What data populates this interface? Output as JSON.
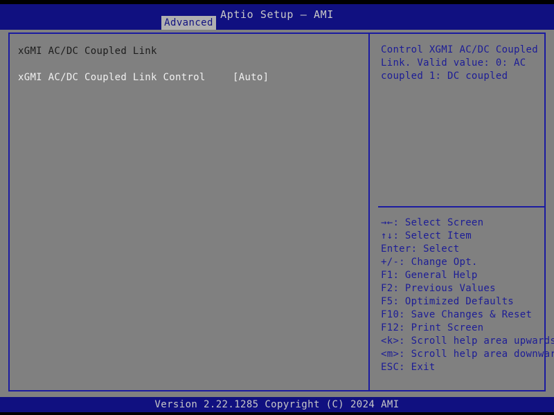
{
  "header": {
    "title": "Aptio Setup – AMI",
    "tabs": [
      {
        "label": "Advanced",
        "active": true
      }
    ]
  },
  "main": {
    "section_heading": "xGMI AC/DC Coupled Link",
    "options": [
      {
        "label": "xGMI AC/DC Coupled Link Control",
        "value": "[Auto]"
      }
    ]
  },
  "help": {
    "lines": [
      "Control XGMI AC/DC Coupled",
      "Link. Valid value: 0: AC",
      "coupled 1: DC coupled"
    ]
  },
  "legend": {
    "items": [
      {
        "key": "→←:",
        "action": " Select Screen"
      },
      {
        "key": "↑↓:",
        "action": " Select Item"
      },
      {
        "key": "Enter:",
        "action": " Select"
      },
      {
        "key": "+/-:",
        "action": " Change Opt."
      },
      {
        "key": "F1:",
        "action": " General Help"
      },
      {
        "key": "F2:",
        "action": " Previous Values"
      },
      {
        "key": "F5:",
        "action": " Optimized Defaults"
      },
      {
        "key": "F10:",
        "action": " Save Changes & Reset"
      },
      {
        "key": "F12:",
        "action": " Print Screen"
      },
      {
        "key": "<k>:",
        "action": " Scroll help area upwards"
      },
      {
        "key": "<m>:",
        "action": " Scroll help area downwards"
      },
      {
        "key": "ESC:",
        "action": " Exit"
      }
    ]
  },
  "footer": {
    "version_text": "Version 2.22.1285 Copyright (C) 2024 AMI"
  },
  "colors": {
    "header_blue": "#101080",
    "body_gray": "#808080",
    "border_blue": "#1a1aa0",
    "help_text_blue": "#1c1c96",
    "light_text": "#f0f0f0",
    "title_text": "#c8c8c8",
    "heading_dark": "#1c1c1c",
    "tab_bg": "#b0b0b0"
  }
}
